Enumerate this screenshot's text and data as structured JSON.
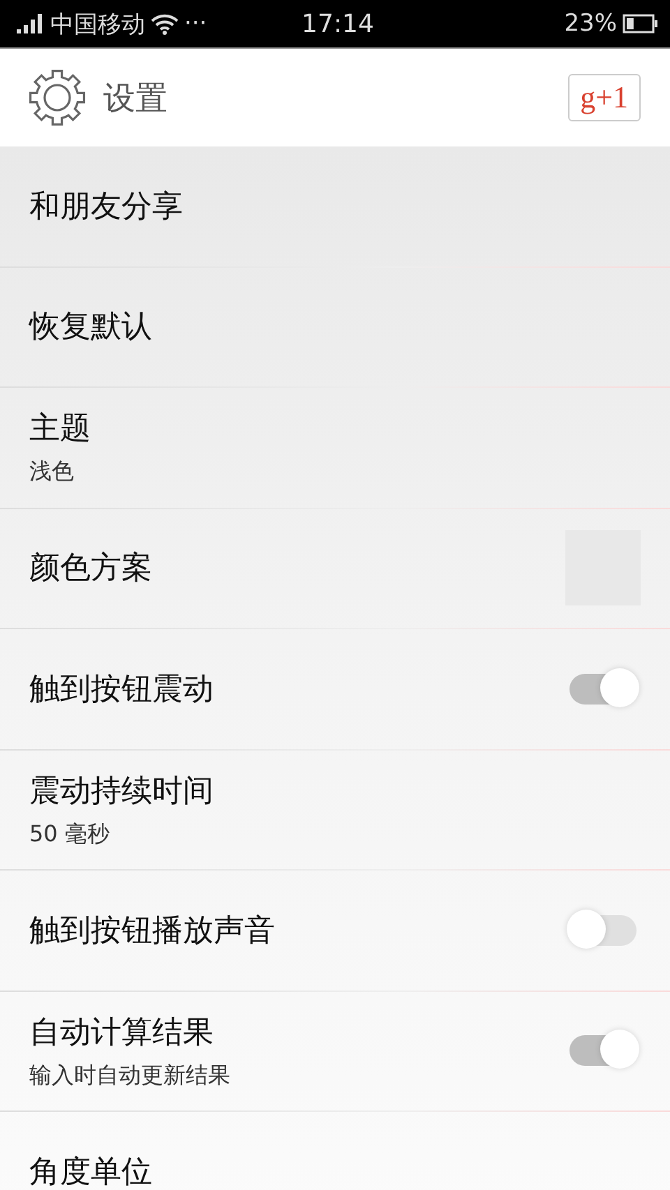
{
  "status_bar": {
    "carrier": "中国移动",
    "more": "···",
    "time": "17:14",
    "battery": "23%"
  },
  "header": {
    "title": "设置",
    "plus_button": "g+1"
  },
  "settings": [
    {
      "kind": "plain",
      "title": "和朋友分享"
    },
    {
      "kind": "plain",
      "title": "恢复默认"
    },
    {
      "kind": "plain",
      "title": "主题",
      "subtitle": "浅色"
    },
    {
      "kind": "swatch",
      "title": "颜色方案"
    },
    {
      "kind": "toggle",
      "title": "触到按钮震动",
      "on": true
    },
    {
      "kind": "plain",
      "title": "震动持续时间",
      "subtitle": "50 毫秒"
    },
    {
      "kind": "toggle",
      "title": "触到按钮播放声音",
      "on": false
    },
    {
      "kind": "toggle",
      "title": "自动计算结果",
      "subtitle": "输入时自动更新结果",
      "on": true
    },
    {
      "kind": "plain",
      "title": "角度单位"
    }
  ]
}
